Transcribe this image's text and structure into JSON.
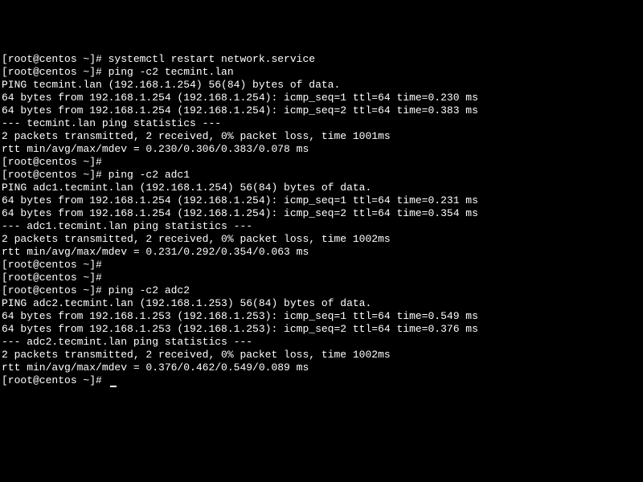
{
  "terminal": {
    "prompt": "[root@centos ~]#",
    "lines": [
      "[root@centos ~]# systemctl restart network.service",
      "[root@centos ~]# ping -c2 tecmint.lan",
      "PING tecmint.lan (192.168.1.254) 56(84) bytes of data.",
      "64 bytes from 192.168.1.254 (192.168.1.254): icmp_seq=1 ttl=64 time=0.230 ms",
      "64 bytes from 192.168.1.254 (192.168.1.254): icmp_seq=2 ttl=64 time=0.383 ms",
      "",
      "--- tecmint.lan ping statistics ---",
      "2 packets transmitted, 2 received, 0% packet loss, time 1001ms",
      "rtt min/avg/max/mdev = 0.230/0.306/0.383/0.078 ms",
      "[root@centos ~]#",
      "[root@centos ~]# ping -c2 adc1",
      "PING adc1.tecmint.lan (192.168.1.254) 56(84) bytes of data.",
      "64 bytes from 192.168.1.254 (192.168.1.254): icmp_seq=1 ttl=64 time=0.231 ms",
      "64 bytes from 192.168.1.254 (192.168.1.254): icmp_seq=2 ttl=64 time=0.354 ms",
      "",
      "--- adc1.tecmint.lan ping statistics ---",
      "2 packets transmitted, 2 received, 0% packet loss, time 1002ms",
      "rtt min/avg/max/mdev = 0.231/0.292/0.354/0.063 ms",
      "[root@centos ~]#",
      "[root@centos ~]#",
      "[root@centos ~]# ping -c2 adc2",
      "PING adc2.tecmint.lan (192.168.1.253) 56(84) bytes of data.",
      "64 bytes from 192.168.1.253 (192.168.1.253): icmp_seq=1 ttl=64 time=0.549 ms",
      "64 bytes from 192.168.1.253 (192.168.1.253): icmp_seq=2 ttl=64 time=0.376 ms",
      "",
      "--- adc2.tecmint.lan ping statistics ---",
      "2 packets transmitted, 2 received, 0% packet loss, time 1002ms",
      "rtt min/avg/max/mdev = 0.376/0.462/0.549/0.089 ms",
      "[root@centos ~]# "
    ]
  }
}
